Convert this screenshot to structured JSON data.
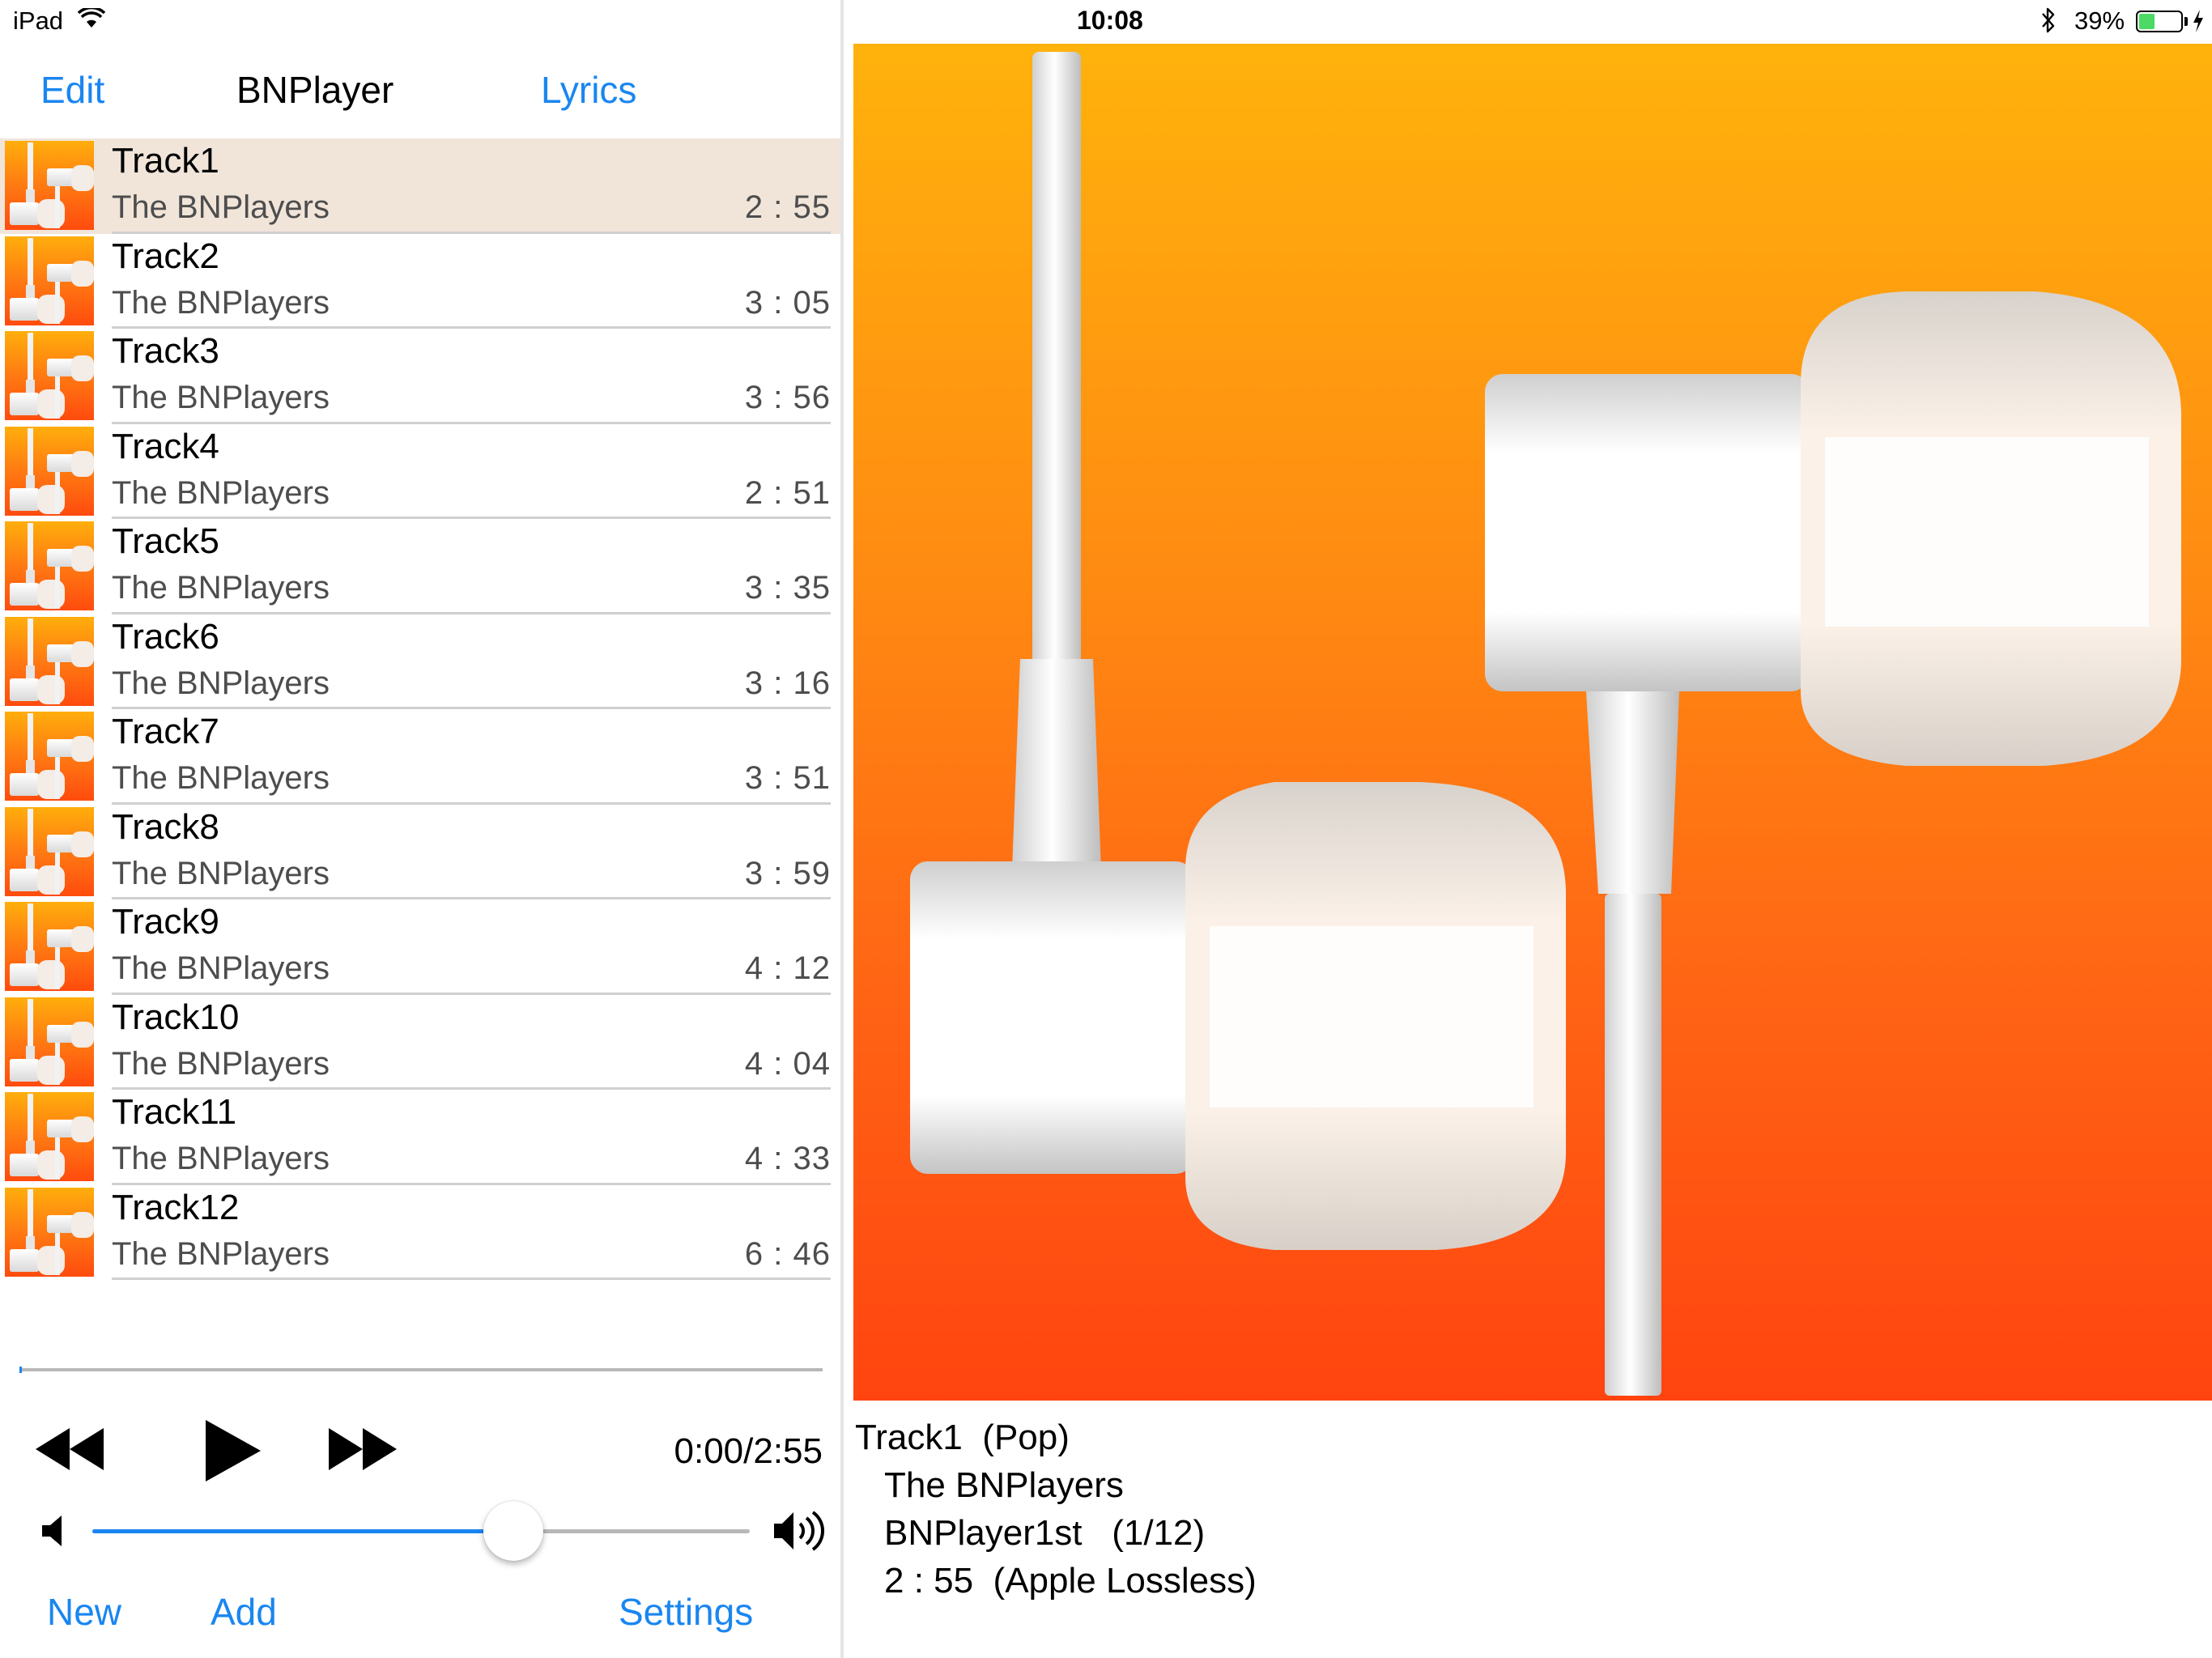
{
  "status_bar": {
    "device": "iPad",
    "time": "10:08",
    "battery_percent": "39%",
    "battery_level": 0.39,
    "icons": [
      "wifi-icon",
      "bluetooth-icon",
      "battery-icon",
      "charging-bolt-icon"
    ]
  },
  "nav": {
    "edit_label": "Edit",
    "title": "BNPlayer",
    "lyrics_label": "Lyrics"
  },
  "tracks": [
    {
      "title": "Track1",
      "artist": "The BNPlayers",
      "duration": "2 : 55",
      "selected": true
    },
    {
      "title": "Track2",
      "artist": "The BNPlayers",
      "duration": "3 : 05"
    },
    {
      "title": "Track3",
      "artist": "The BNPlayers",
      "duration": "3 : 56"
    },
    {
      "title": "Track4",
      "artist": "The BNPlayers",
      "duration": "2 : 51"
    },
    {
      "title": "Track5",
      "artist": "The BNPlayers",
      "duration": "3 : 35"
    },
    {
      "title": "Track6",
      "artist": "The BNPlayers",
      "duration": "3 : 16"
    },
    {
      "title": "Track7",
      "artist": "The BNPlayers",
      "duration": "3 : 51"
    },
    {
      "title": "Track8",
      "artist": "The BNPlayers",
      "duration": "3 : 59"
    },
    {
      "title": "Track9",
      "artist": "The BNPlayers",
      "duration": "4 : 12"
    },
    {
      "title": "Track10",
      "artist": "The BNPlayers",
      "duration": "4 : 04"
    },
    {
      "title": "Track11",
      "artist": "The BNPlayers",
      "duration": "4 : 33"
    },
    {
      "title": "Track12",
      "artist": "The BNPlayers",
      "duration": "6 : 46"
    }
  ],
  "player": {
    "time_readout": "0:00/2:55",
    "progress": 0.0,
    "volume": 0.64,
    "icons": [
      "rewind-icon",
      "play-icon",
      "fast-forward-icon",
      "volume-low-icon",
      "volume-high-icon"
    ]
  },
  "toolbar": {
    "new_label": "New",
    "add_label": "Add",
    "settings_label": "Settings"
  },
  "now_playing": {
    "line1": "Track1  (Pop)",
    "line2": "The BNPlayers",
    "line3": "BNPlayer1st   (1/12)",
    "line4": "2 : 55  (Apple Lossless)"
  },
  "colors": {
    "accent": "#1a86f0",
    "selected_row": "#f1e5da",
    "artwork_top": "#ffb20c",
    "artwork_bottom": "#ff4410"
  }
}
